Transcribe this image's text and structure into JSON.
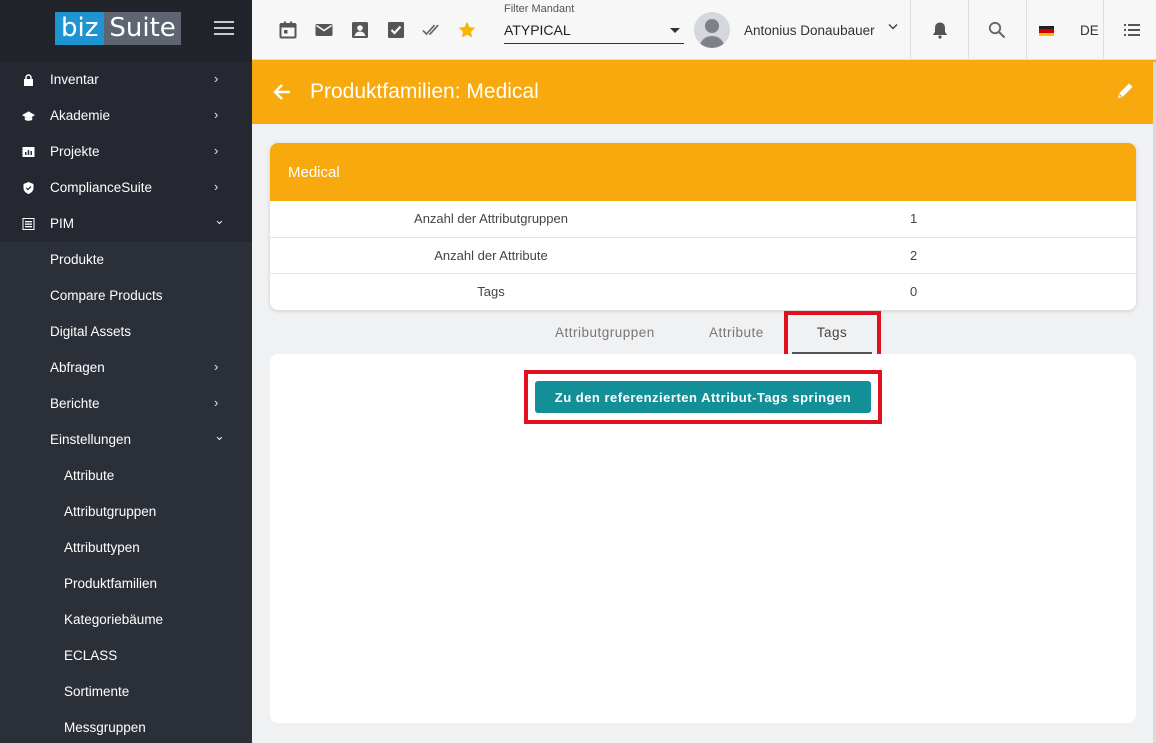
{
  "brand": {
    "part1": "biz",
    "part2": "Suite"
  },
  "sidebar": {
    "items": [
      {
        "label": "Inventar",
        "icon": "lock-icon",
        "chevron": "›"
      },
      {
        "label": "Akademie",
        "icon": "graduation-cap-icon",
        "chevron": "›"
      },
      {
        "label": "Projekte",
        "icon": "chart-icon",
        "chevron": "›"
      },
      {
        "label": "ComplianceSuite",
        "icon": "shield-icon",
        "chevron": "›"
      },
      {
        "label": "PIM",
        "icon": "list-box-icon",
        "chevron": "⌄"
      },
      {
        "label": "Produkte"
      },
      {
        "label": "Compare Products"
      },
      {
        "label": "Digital Assets"
      },
      {
        "label": "Abfragen",
        "chevron": "›"
      },
      {
        "label": "Berichte",
        "chevron": "›"
      },
      {
        "label": "Einstellungen",
        "chevron": "⌄"
      },
      {
        "label": "Attribute"
      },
      {
        "label": "Attributgruppen"
      },
      {
        "label": "Attributtypen"
      },
      {
        "label": "Produktfamilien"
      },
      {
        "label": "Kategoriebäume"
      },
      {
        "label": "ECLASS"
      },
      {
        "label": "Sortimente"
      },
      {
        "label": "Messgruppen"
      }
    ]
  },
  "topbar": {
    "filter_label": "Filter Mandant",
    "filter_value": "ATYPICAL",
    "username": "Antonius Donaubauer",
    "language": "DE",
    "colors": {
      "star": "#f7b500"
    }
  },
  "header": {
    "title": "Produktfamilien: Medical"
  },
  "card": {
    "title": "Medical",
    "rows": [
      {
        "key": "Anzahl der Attributgruppen",
        "value": "1"
      },
      {
        "key": "Anzahl der Attribute",
        "value": "2"
      },
      {
        "key": "Tags",
        "value": "0"
      }
    ]
  },
  "tabs": [
    {
      "label": "Attributgruppen"
    },
    {
      "label": "Attribute"
    },
    {
      "label": "Tags"
    }
  ],
  "panel": {
    "button_label": "Zu den referenzierten Attribut-Tags springen"
  },
  "colors": {
    "accent": "#f7a90d",
    "button": "#138f98",
    "sidebar": "#2b2f38",
    "highlight": "#e0101e"
  }
}
